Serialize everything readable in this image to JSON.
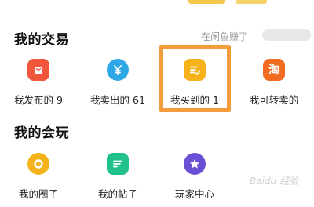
{
  "section_trade": {
    "title": "我的交易",
    "promo_text": "在闲鱼赚了",
    "items": [
      {
        "label": "我发布的 9",
        "icon": "shopping-bag-icon",
        "color": "#f1553b"
      },
      {
        "label": "我卖出的 61",
        "icon": "yuan-icon",
        "color": "#2ea7e6"
      },
      {
        "label": "我买到的 1",
        "icon": "checklist-edit-icon",
        "color": "#f5b21b"
      },
      {
        "label": "我可转卖的",
        "icon": "tao-icon",
        "glyph": "淘",
        "color": "#f36b21"
      }
    ]
  },
  "section_play": {
    "title": "我的会玩",
    "items": [
      {
        "label": "我的圈子",
        "icon": "circle-icon",
        "color": "#f5b21b"
      },
      {
        "label": "我的帖子",
        "icon": "post-icon",
        "color": "#22c08a"
      },
      {
        "label": "玩家中心",
        "icon": "star-badge-icon",
        "color": "#6a4fd4"
      }
    ]
  },
  "watermark": "Baidu 经验",
  "highlight_color": "#f39c3c"
}
